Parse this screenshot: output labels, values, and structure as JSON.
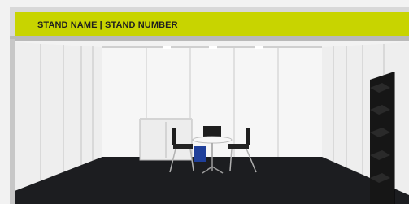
{
  "fascia": {
    "label": "STAND NAME | STAND NUMBER",
    "color": "#c8d400",
    "text_color": "#1f1f1f"
  },
  "colors": {
    "panel": "#f4f4f4",
    "frame": "#bdbdbd",
    "carpet": "#1c1d20"
  },
  "furniture": [
    "storage-cabinet",
    "round-table",
    "chair",
    "chair",
    "chair",
    "brochure-rack"
  ]
}
